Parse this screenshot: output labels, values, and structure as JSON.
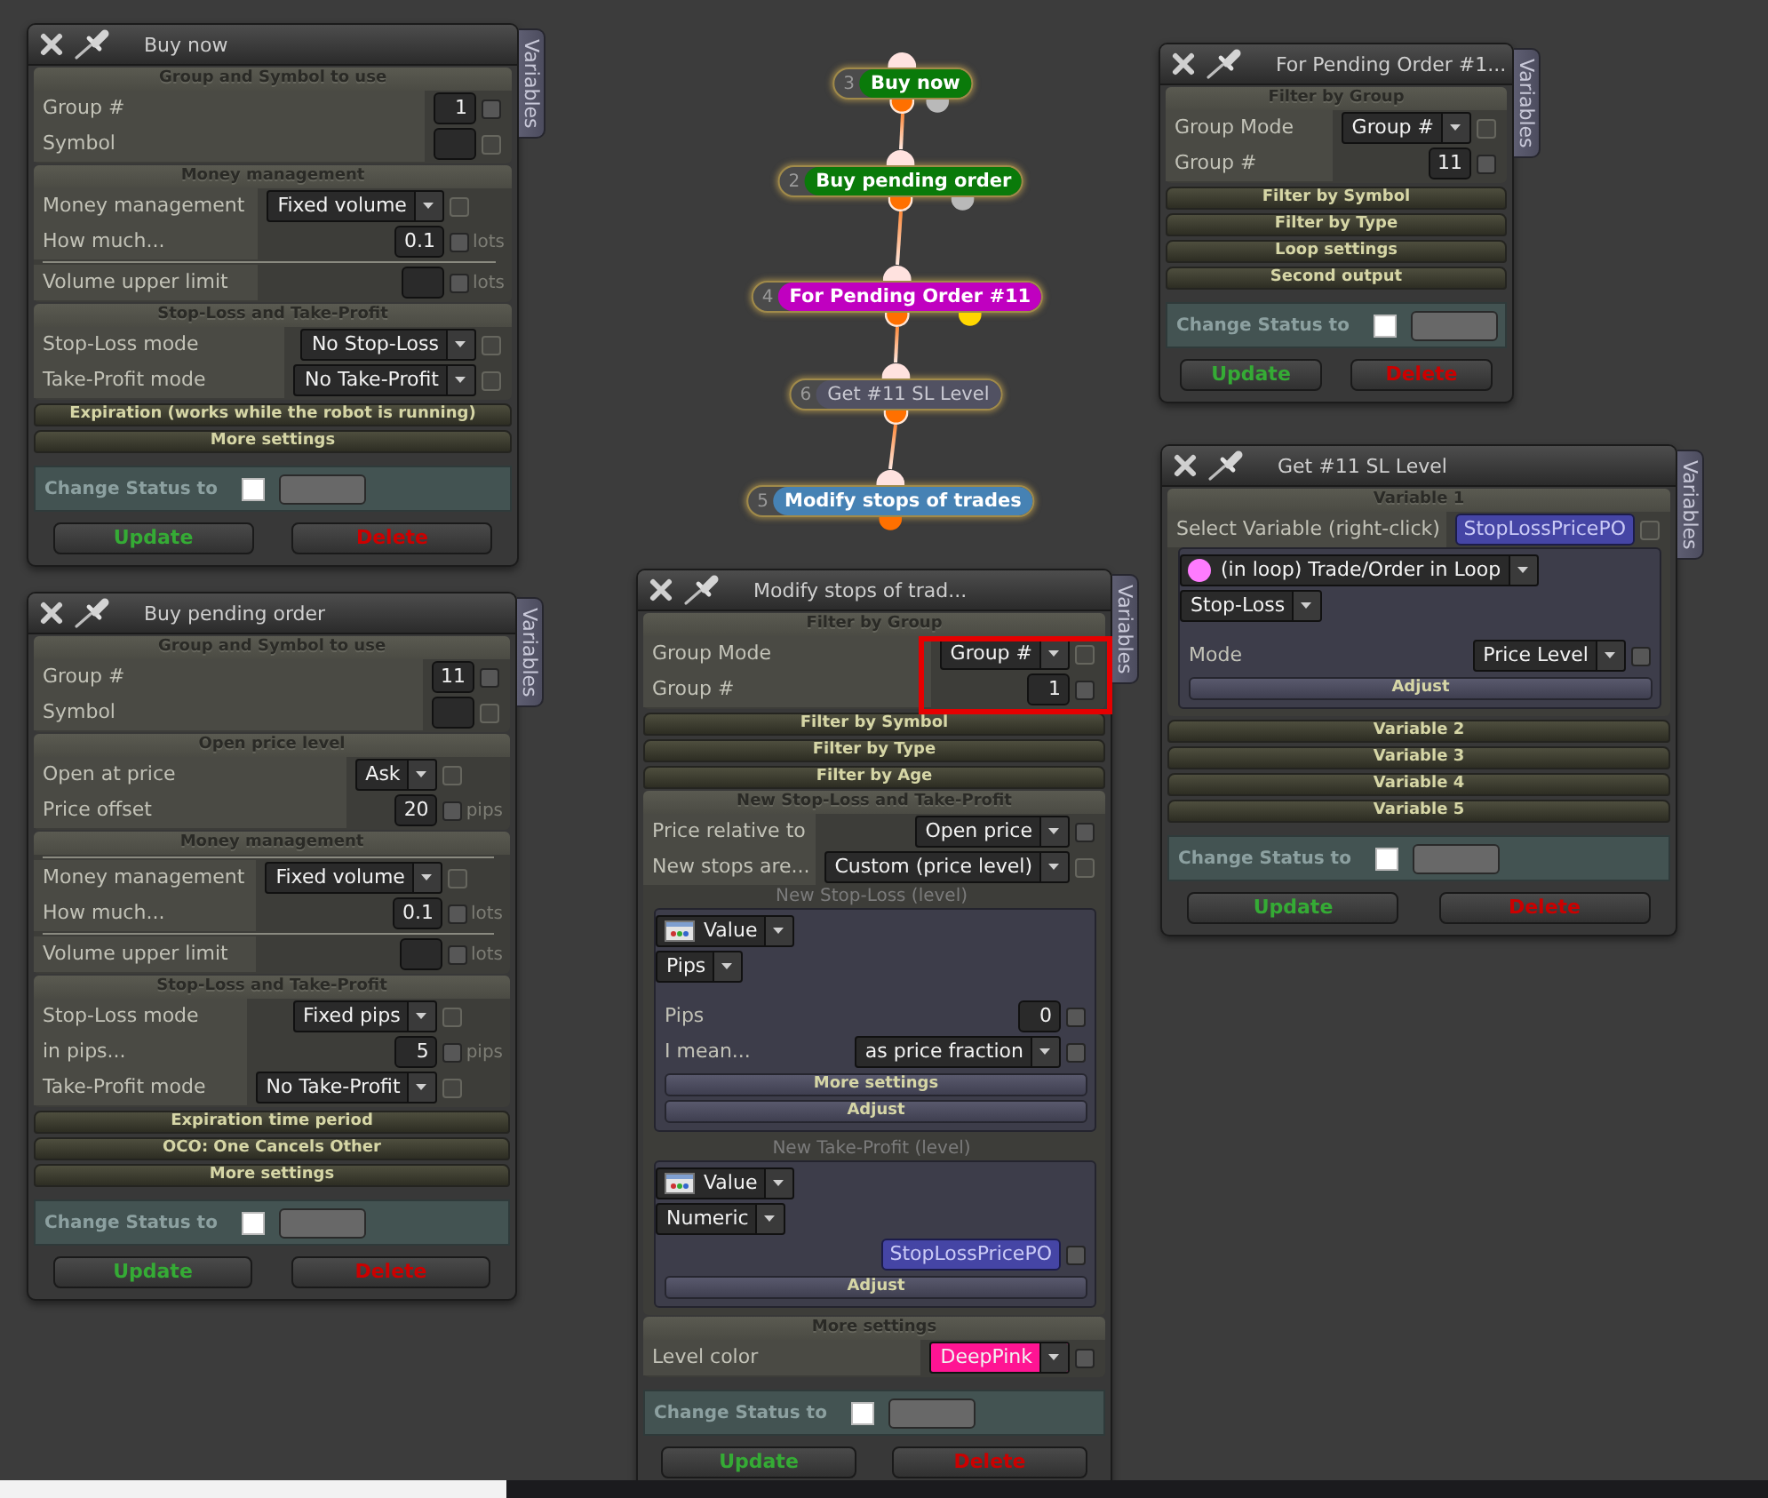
{
  "panels": [
    {
      "title": "Buy now",
      "side_tab": "Variables",
      "sections": [
        {
          "title": "Group and Symbol to use",
          "expanded": true,
          "rows": [
            {
              "kind": "input",
              "label": "Group #",
              "value": "1",
              "checkbox": {
                "checked": false,
                "disabled": false
              }
            },
            {
              "kind": "input",
              "label": "Symbol",
              "checkbox": {
                "checked": false,
                "disabled": true
              }
            }
          ]
        },
        {
          "title": "Money management",
          "expanded": true,
          "rows": [
            {
              "kind": "select",
              "label": "Money management",
              "value": "Fixed volume",
              "checkbox": {
                "checked": false,
                "disabled": true
              }
            },
            {
              "kind": "input",
              "label": "How much...",
              "value": "0.1",
              "unit": "lots",
              "checkbox": {
                "checked": false,
                "disabled": false
              }
            },
            {
              "kind": "divider"
            },
            {
              "kind": "input",
              "label": "Volume upper limit",
              "unit": "lots",
              "checkbox": {
                "checked": false,
                "disabled": false
              }
            }
          ]
        },
        {
          "title": "Stop-Loss and Take-Profit",
          "expanded": true,
          "rows": [
            {
              "kind": "select",
              "label": "Stop-Loss mode",
              "value": "No Stop-Loss",
              "checkbox": {
                "checked": false,
                "disabled": true
              }
            },
            {
              "kind": "select",
              "label": "Take-Profit mode",
              "value": "No Take-Profit",
              "checkbox": {
                "checked": false,
                "disabled": true
              }
            }
          ]
        },
        {
          "title": "Expiration (works while the robot is running)",
          "expanded": false
        },
        {
          "title": "More settings",
          "expanded": false
        }
      ],
      "status": {
        "label": "Change Status to",
        "checked": false
      },
      "buttons": [
        {
          "label": "Update",
          "kind": "update"
        },
        {
          "label": "Delete",
          "kind": "delete"
        }
      ]
    },
    {
      "title": "Buy pending order",
      "side_tab": "Variables",
      "sections": [
        {
          "title": "Group and Symbol to use",
          "expanded": true,
          "rows": [
            {
              "kind": "input",
              "label": "Group #",
              "value": "11",
              "checkbox": {
                "checked": false,
                "disabled": false
              }
            },
            {
              "kind": "input",
              "label": "Symbol",
              "checkbox": {
                "checked": false,
                "disabled": true
              }
            }
          ]
        },
        {
          "title": "Open price level",
          "expanded": true,
          "rows": [
            {
              "kind": "select",
              "label": "Open at price",
              "value": "Ask",
              "checkbox": {
                "checked": false,
                "disabled": true
              }
            },
            {
              "kind": "input",
              "label": "Price offset",
              "value": "20",
              "unit": "pips",
              "checkbox": {
                "checked": false,
                "disabled": false
              }
            }
          ]
        },
        {
          "title": "Money management",
          "expanded": true,
          "rows": [
            {
              "kind": "divider"
            },
            {
              "kind": "select",
              "label": "Money management",
              "value": "Fixed volume",
              "checkbox": {
                "checked": false,
                "disabled": true
              }
            },
            {
              "kind": "input",
              "label": "How much...",
              "value": "0.1",
              "unit": "lots",
              "checkbox": {
                "checked": false,
                "disabled": false
              }
            },
            {
              "kind": "divider"
            },
            {
              "kind": "input",
              "label": "Volume upper limit",
              "unit": "lots",
              "checkbox": {
                "checked": false,
                "disabled": false
              }
            }
          ]
        },
        {
          "title": "Stop-Loss and Take-Profit",
          "expanded": true,
          "rows": [
            {
              "kind": "select",
              "label": "Stop-Loss mode",
              "value": "Fixed pips",
              "checkbox": {
                "checked": false,
                "disabled": true
              }
            },
            {
              "kind": "input",
              "label": "in pips...",
              "value": "5",
              "unit": "pips",
              "checkbox": {
                "checked": false,
                "disabled": false
              }
            },
            {
              "kind": "select",
              "label": "Take-Profit mode",
              "value": "No Take-Profit",
              "checkbox": {
                "checked": false,
                "disabled": true
              }
            }
          ]
        },
        {
          "title": "Expiration time period",
          "expanded": false
        },
        {
          "title": "OCO: One Cancels Other",
          "expanded": false
        },
        {
          "title": "More settings",
          "expanded": false
        }
      ],
      "status": {
        "label": "Change Status to",
        "checked": false
      },
      "buttons": [
        {
          "label": "Update",
          "kind": "update"
        },
        {
          "label": "Delete",
          "kind": "delete"
        }
      ]
    },
    {
      "title": "Modify stops of trad...",
      "side_tab": "Variables",
      "sections": [
        {
          "title": "Filter by Group",
          "expanded": true,
          "highlighted": true,
          "rows": [
            {
              "kind": "select",
              "label": "Group Mode",
              "value": "Group #",
              "checkbox": {
                "checked": false,
                "disabled": true
              }
            },
            {
              "kind": "input",
              "label": "Group #",
              "value": "1",
              "checkbox": {
                "checked": false,
                "disabled": false
              }
            }
          ]
        },
        {
          "title": "Filter by Symbol",
          "expanded": false
        },
        {
          "title": "Filter by Type",
          "expanded": false
        },
        {
          "title": "Filter by Age",
          "expanded": false
        },
        {
          "title": "New Stop-Loss and Take-Profit",
          "expanded": true,
          "rows": [
            {
              "kind": "select",
              "label": "Price relative to",
              "value": "Open price",
              "checkbox": {
                "checked": false,
                "disabled": false
              }
            },
            {
              "kind": "select",
              "label": "New stops are...",
              "value": "Custom (price level)",
              "checkbox": {
                "checked": false,
                "disabled": true
              }
            },
            {
              "kind": "caption",
              "text": "New Stop-Loss (level)"
            },
            {
              "kind": "box",
              "rows": [
                {
                  "kind": "source",
                  "value": "Value"
                },
                {
                  "kind": "select",
                  "value": "Pips"
                },
                {
                  "kind": "input",
                  "label": "Pips",
                  "value": "0",
                  "checkbox": {
                    "checked": false,
                    "disabled": false
                  }
                },
                {
                  "kind": "select",
                  "label": "I mean...",
                  "value": "as price fraction",
                  "checkbox": {
                    "checked": false,
                    "disabled": false
                  }
                },
                {
                  "kind": "bar",
                  "label": "More settings"
                },
                {
                  "kind": "bar",
                  "label": "Adjust"
                }
              ]
            },
            {
              "kind": "caption",
              "text": "New Take-Profit (level)"
            },
            {
              "kind": "box",
              "rows": [
                {
                  "kind": "source",
                  "value": "Value"
                },
                {
                  "kind": "select",
                  "value": "Numeric"
                },
                {
                  "kind": "chip",
                  "value": "StopLossPricePO",
                  "checkbox": {
                    "checked": false,
                    "disabled": false
                  }
                },
                {
                  "kind": "bar",
                  "label": "Adjust"
                }
              ]
            }
          ]
        },
        {
          "title": "More settings",
          "expanded": true,
          "rows": [
            {
              "kind": "select",
              "label": "Level color",
              "value": "DeepPink",
              "color": "#ff1493",
              "checkbox": {
                "checked": false,
                "disabled": false
              }
            }
          ]
        }
      ],
      "status": {
        "label": "Change Status to",
        "checked": false
      },
      "buttons": [
        {
          "label": "Update",
          "kind": "update"
        },
        {
          "label": "Delete",
          "kind": "delete"
        }
      ]
    },
    {
      "title": "For Pending Order #1...",
      "side_tab": "Variables",
      "sections": [
        {
          "title": "Filter by Group",
          "expanded": true,
          "rows": [
            {
              "kind": "select",
              "label": "Group Mode",
              "value": "Group #",
              "checkbox": {
                "checked": false,
                "disabled": true
              }
            },
            {
              "kind": "input",
              "label": "Group #",
              "value": "11",
              "checkbox": {
                "checked": false,
                "disabled": false
              }
            }
          ]
        },
        {
          "title": "Filter by Symbol",
          "expanded": false
        },
        {
          "title": "Filter by Type",
          "expanded": false
        },
        {
          "title": "Loop settings",
          "expanded": false
        },
        {
          "title": "Second output",
          "expanded": false
        }
      ],
      "status": {
        "label": "Change Status to",
        "checked": false
      },
      "buttons": [
        {
          "label": "Update",
          "kind": "update"
        },
        {
          "label": "Delete",
          "kind": "delete"
        }
      ]
    },
    {
      "title": "Get #11 SL Level",
      "side_tab": "Variables",
      "sections": [
        {
          "title": "Variable 1",
          "expanded": true,
          "rows": [
            {
              "kind": "chip",
              "label": "Select Variable (right-click)",
              "value": "StopLossPricePO",
              "checkbox": {
                "checked": false,
                "disabled": true
              }
            },
            {
              "kind": "box",
              "rows": [
                {
                  "kind": "loop",
                  "value": "(in loop) Trade/Order in Loop"
                },
                {
                  "kind": "select",
                  "value": "Stop-Loss"
                },
                {
                  "kind": "select",
                  "label": "Mode",
                  "value": "Price Level",
                  "checkbox": {
                    "checked": false,
                    "disabled": false
                  }
                },
                {
                  "kind": "bar",
                  "label": "Adjust"
                }
              ]
            }
          ]
        },
        {
          "title": "Variable 2",
          "expanded": false
        },
        {
          "title": "Variable 3",
          "expanded": false
        },
        {
          "title": "Variable 4",
          "expanded": false
        },
        {
          "title": "Variable 5",
          "expanded": false
        }
      ],
      "status": {
        "label": "Change Status to",
        "checked": false
      },
      "buttons": [
        {
          "label": "Update",
          "kind": "update"
        },
        {
          "label": "Delete",
          "kind": "delete"
        }
      ]
    }
  ],
  "flow": {
    "nodes": [
      {
        "number": "3",
        "label": "Buy now",
        "kind": "action",
        "color": "#0a7a0a",
        "outputs": [
          {
            "color": "#ff7000",
            "connected": true
          },
          {
            "color": "#b9b9b9",
            "connected": false
          }
        ]
      },
      {
        "number": "2",
        "label": "Buy pending order",
        "kind": "action",
        "color": "#0a7a0a",
        "outputs": [
          {
            "color": "#ff7000",
            "connected": true
          },
          {
            "color": "#b9b9b9",
            "connected": false
          }
        ]
      },
      {
        "number": "4",
        "label": "For Pending Order #11",
        "kind": "action",
        "color": "#c000c0",
        "outputs": [
          {
            "color": "#ff7000",
            "connected": true
          },
          {
            "color": "#ffd700",
            "connected": false
          }
        ]
      },
      {
        "number": "6",
        "label": "Get #11 SL Level",
        "kind": "variable",
        "color": "#515162",
        "outputs": [
          {
            "color": "#ff7000",
            "connected": true
          }
        ]
      },
      {
        "number": "5",
        "label": "Modify stops of trades",
        "kind": "action",
        "color": "#4682b4",
        "outputs": [
          {
            "color": "#ff7000",
            "connected": false
          }
        ]
      }
    ]
  }
}
